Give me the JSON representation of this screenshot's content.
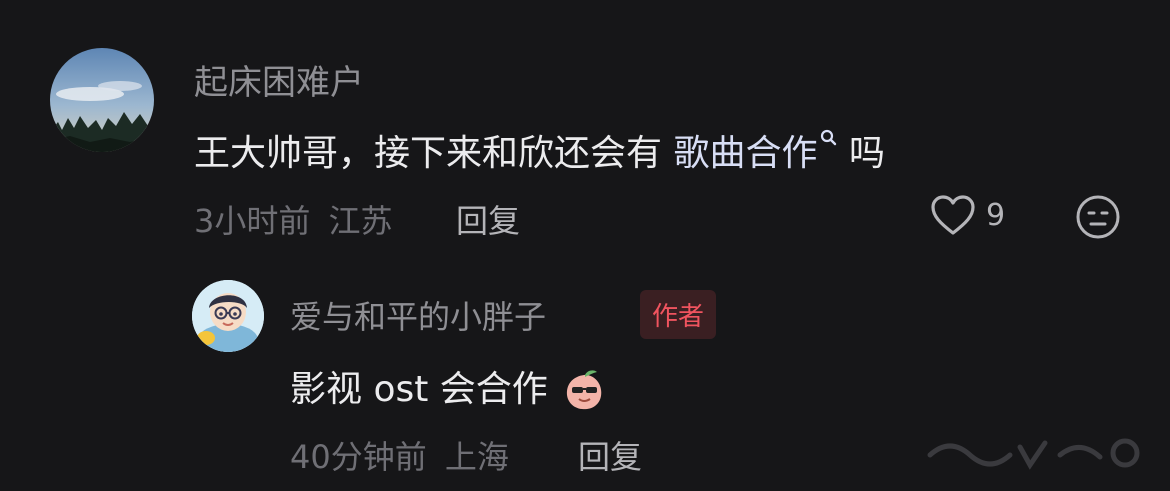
{
  "comments": [
    {
      "username": "起床困难户",
      "text_before": "王大帅哥，接下来和欣还会有",
      "link_text": "歌曲合作",
      "text_after": "吗",
      "time": "3小时前",
      "location": "江苏",
      "reply_label": "回复",
      "like_count": "9",
      "avatar_icon": "avatar-sky-trees",
      "like_icon": "heart-outline-icon",
      "emoji_icon": "neutral-face-icon"
    }
  ],
  "replies": [
    {
      "username": "爱与和平的小胖子",
      "badge": "作者",
      "text": "影视 ost 会合作",
      "time": "40分钟前",
      "location": "上海",
      "reply_label": "回复",
      "avatar_icon": "avatar-cartoon-boy",
      "sticker_icon": "peach-sunglasses-sticker"
    }
  ],
  "colors": {
    "background": "#161618",
    "badge_text": "#f0545f",
    "badge_bg": "#3a1f22",
    "link": "#d8def5"
  }
}
